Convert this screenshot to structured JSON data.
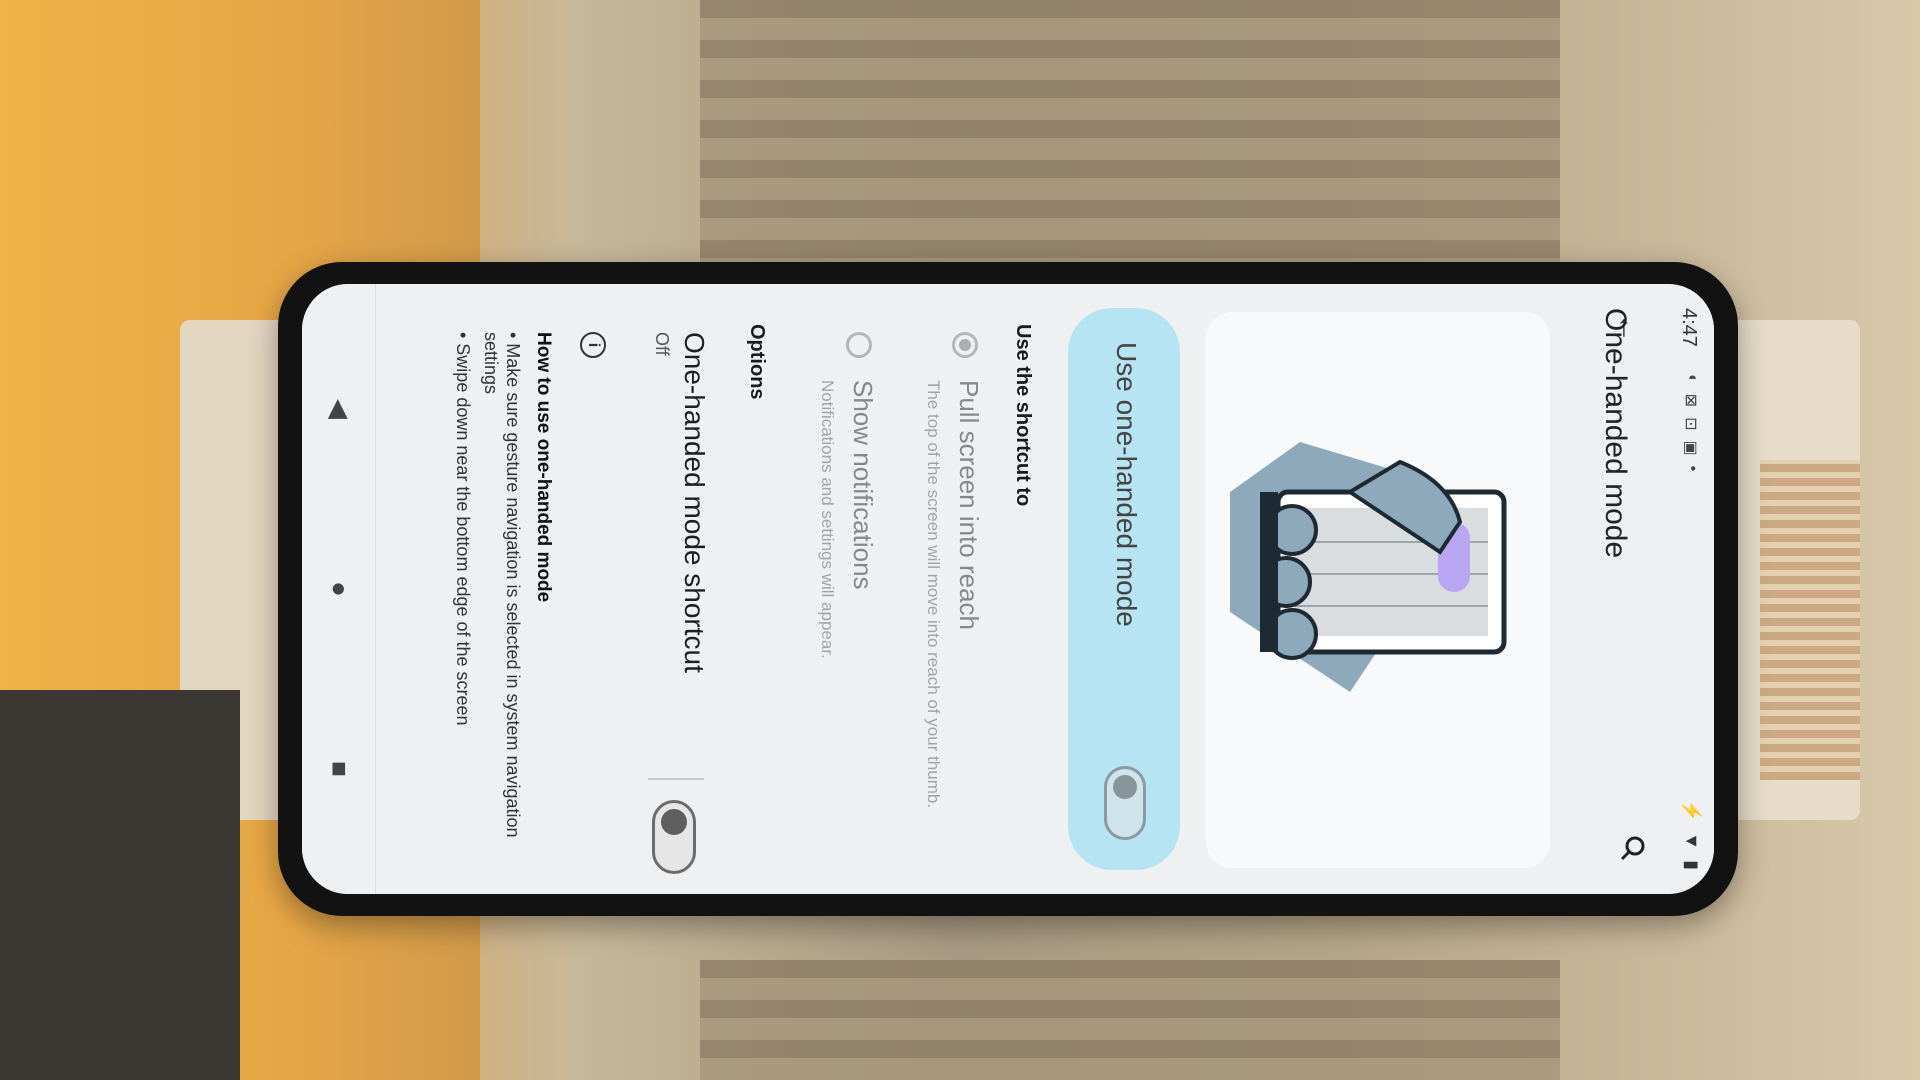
{
  "status_bar": {
    "time": "4:47"
  },
  "app_bar": {
    "title": "One-handed mode"
  },
  "main_toggle": {
    "label": "Use one-handed mode",
    "state": "off"
  },
  "shortcut_section": {
    "header": "Use the shortcut to",
    "options": [
      {
        "title": "Pull screen into reach",
        "subtitle": "The top of the screen will move into reach of your thumb.",
        "selected": true
      },
      {
        "title": "Show notifications",
        "subtitle": "Notifications and settings will appear.",
        "selected": false
      }
    ]
  },
  "options_section": {
    "header": "Options",
    "shortcut_title": "One-handed mode shortcut",
    "shortcut_status": "Off"
  },
  "howto": {
    "title": "How to use one-handed mode",
    "items": [
      "• Make sure gesture navigation is selected in system navigation settings",
      "• Swipe down near the bottom edge of the screen"
    ]
  },
  "colors": {
    "toggle_card_bg": "#b7e4f2",
    "screen_bg": "#eef0f1",
    "illustration_hand": "#8fa9bc",
    "illustration_accent": "#b9a6f2"
  }
}
